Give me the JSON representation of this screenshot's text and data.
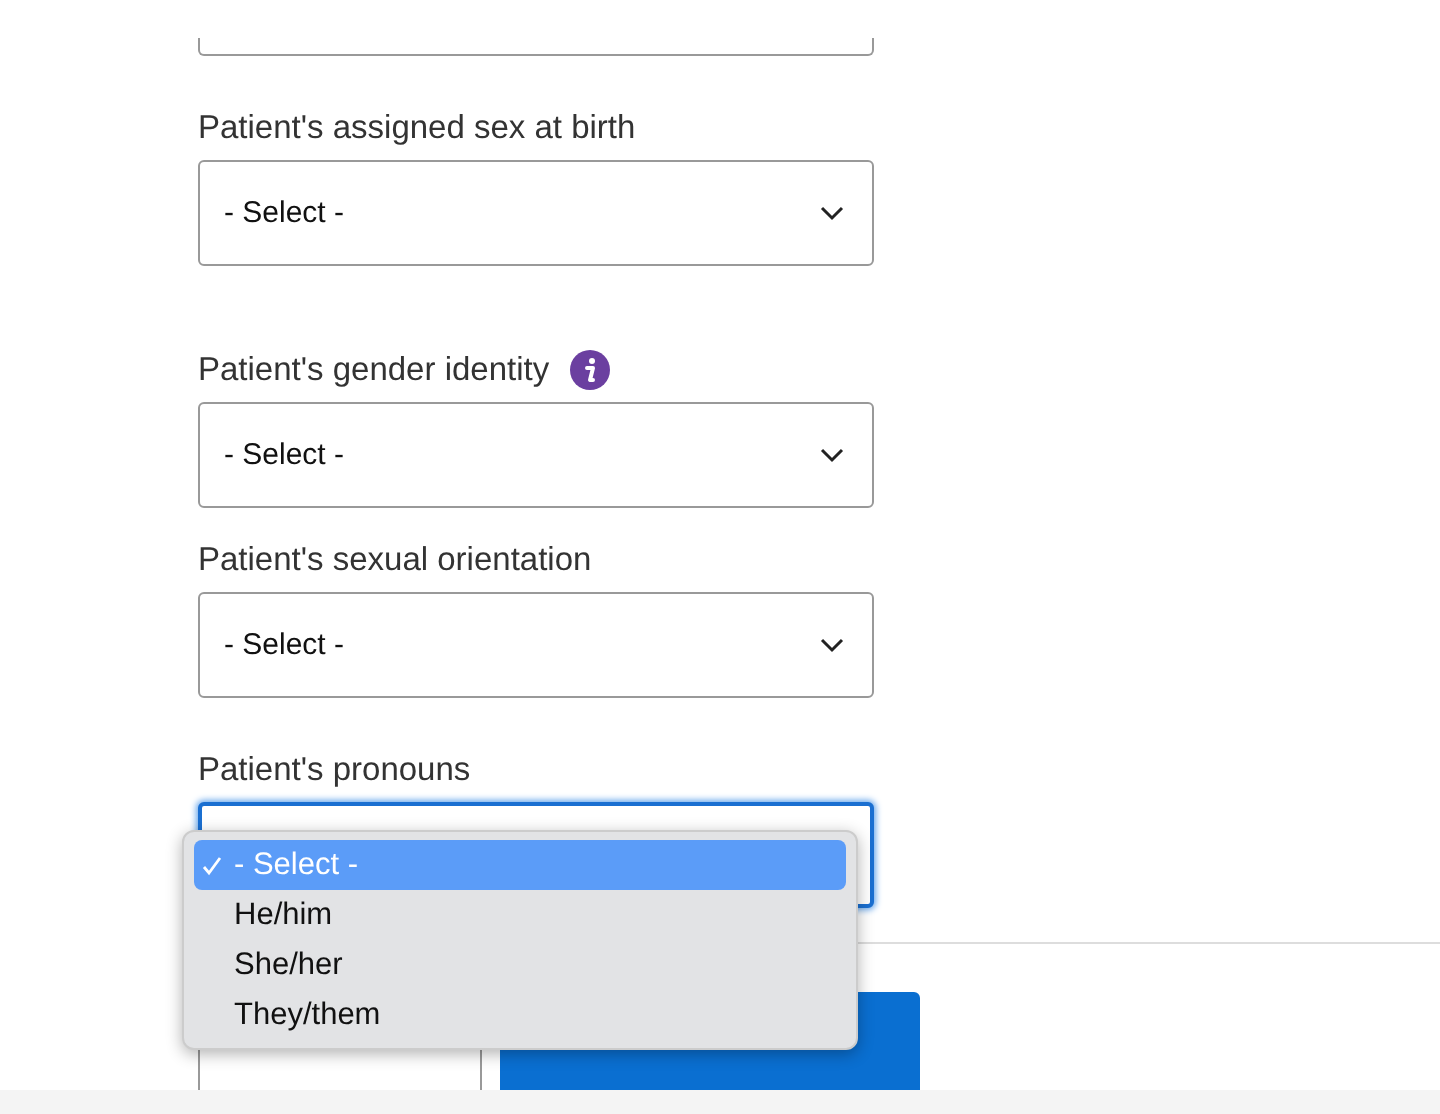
{
  "fields": [
    {
      "kind": "cut"
    },
    {
      "kind": "select",
      "label": "Patient's assigned sex at birth",
      "value": "- Select -",
      "info": false,
      "focused": false
    },
    {
      "kind": "select",
      "label": "Patient's gender identity",
      "value": "- Select -",
      "info": true,
      "focused": false
    },
    {
      "kind": "select",
      "label": "Patient's sexual orientation",
      "value": "- Select -",
      "info": false,
      "focused": false
    },
    {
      "kind": "select",
      "label": "Patient's pronouns",
      "info": false,
      "focused": true,
      "options": [
        {
          "label": "- Select -",
          "selected": true
        },
        {
          "label": "He/him",
          "selected": false
        },
        {
          "label": "She/her",
          "selected": false
        },
        {
          "label": "They/them",
          "selected": false
        }
      ]
    }
  ],
  "buttons": [
    {
      "kind": "secondary"
    },
    {
      "kind": "primary"
    }
  ]
}
